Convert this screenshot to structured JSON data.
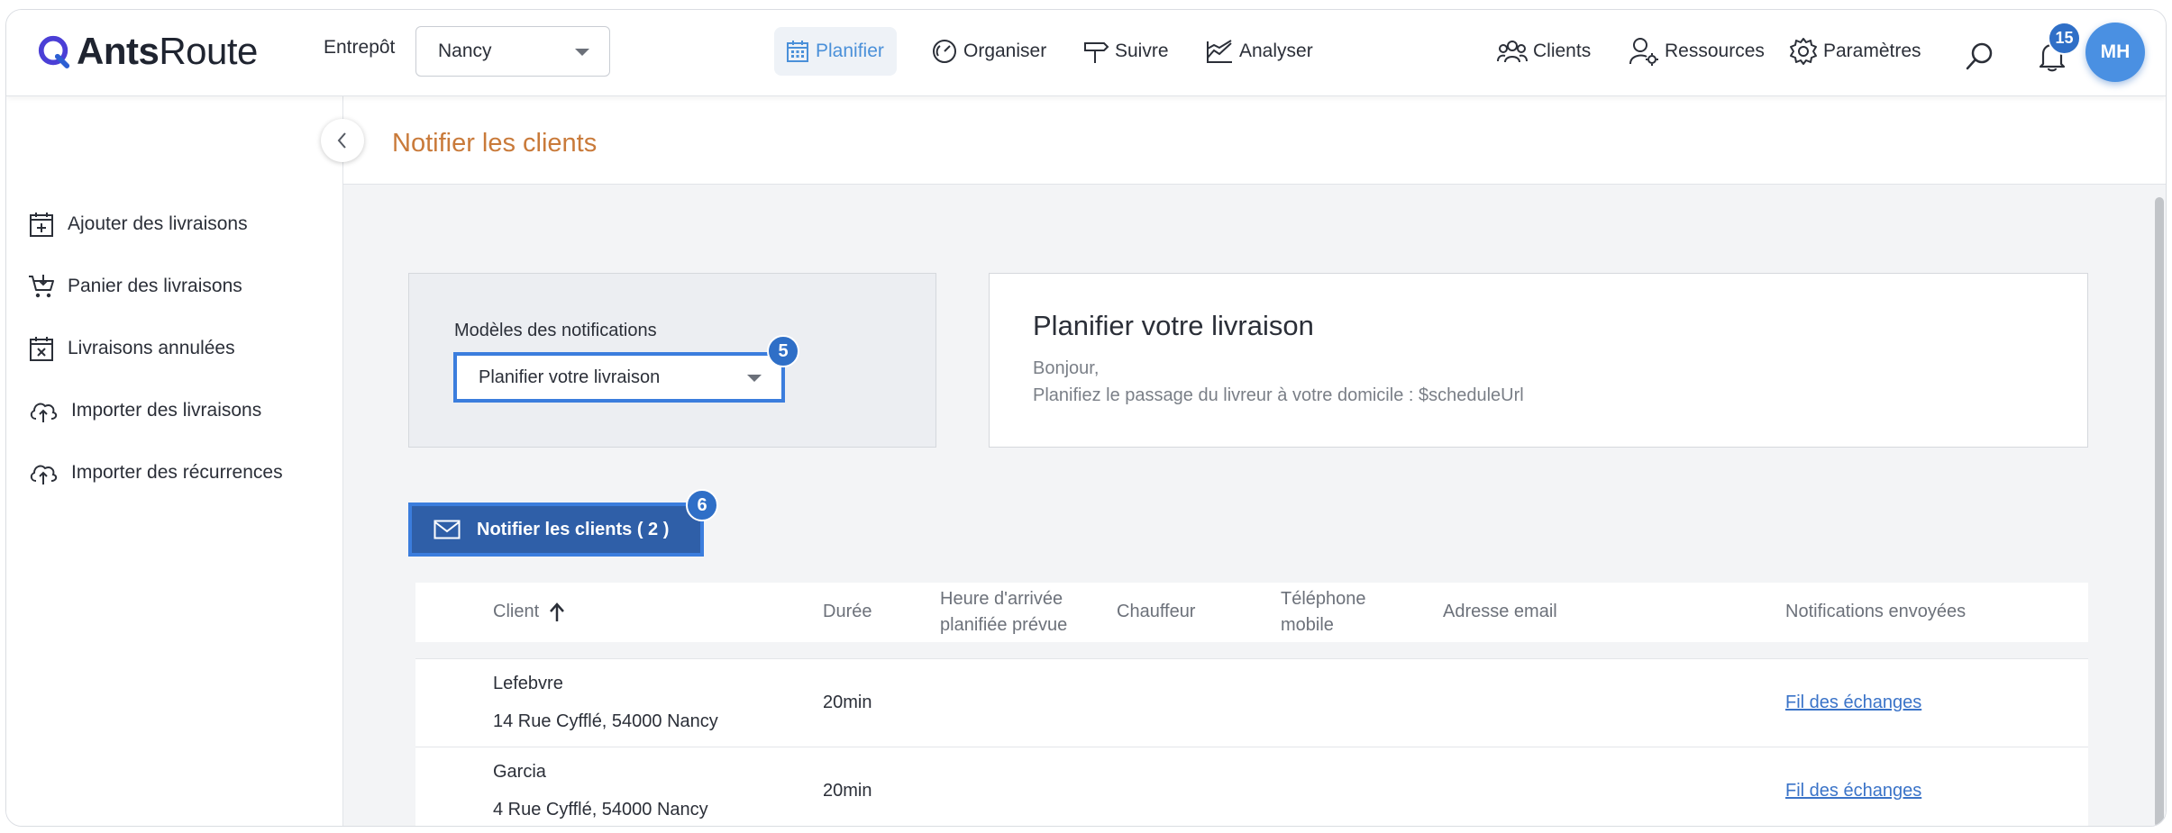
{
  "app": {
    "logo_bold": "Ants",
    "logo_light": "Route"
  },
  "warehouse": {
    "label": "Entrepôt",
    "value": "Nancy"
  },
  "nav": {
    "planifier": "Planifier",
    "organiser": "Organiser",
    "suivre": "Suivre",
    "analyser": "Analyser",
    "clients": "Clients",
    "ressources": "Ressources",
    "parametres": "Paramètres"
  },
  "notifications": {
    "count": "15"
  },
  "user": {
    "initials": "MH"
  },
  "sidebar": {
    "items": [
      {
        "label": "Ajouter des livraisons",
        "icon": "calendar-plus-icon"
      },
      {
        "label": "Panier des livraisons",
        "icon": "cart-icon"
      },
      {
        "label": "Livraisons annulées",
        "icon": "calendar-x-icon"
      },
      {
        "label": "Importer des livraisons",
        "icon": "cloud-upload-icon"
      },
      {
        "label": "Importer des récurrences",
        "icon": "cloud-upload-icon"
      }
    ]
  },
  "page": {
    "title": "Notifier les clients"
  },
  "templates": {
    "label": "Modèles des notifications",
    "selected": "Planifier votre livraison",
    "step_badge": "5"
  },
  "preview": {
    "title": "Planifier votre livraison",
    "line1": "Bonjour,",
    "line2": "Planifiez le passage du livreur à votre domicile : $scheduleUrl"
  },
  "notify_button": {
    "label": "Notifier les clients ( 2 )",
    "step_badge": "6"
  },
  "table": {
    "headers": {
      "client": "Client",
      "duree": "Durée",
      "heure_l1": "Heure d'arrivée",
      "heure_l2": "planifiée prévue",
      "chauffeur": "Chauffeur",
      "tel_l1": "Téléphone",
      "tel_l2": "mobile",
      "email": "Adresse email",
      "notifs": "Notifications envoyées"
    },
    "rows": [
      {
        "name": "Lefebvre",
        "address": "14 Rue Cyfflé, 54000 Nancy",
        "duration": "20min",
        "link": "Fil des échanges"
      },
      {
        "name": "Garcia",
        "address": "4 Rue Cyfflé, 54000 Nancy",
        "duration": "20min",
        "link": "Fil des échanges"
      }
    ]
  },
  "colors": {
    "accent": "#3b7ddd",
    "title_orange": "#c97a3a",
    "button_blue": "#2f5fa8",
    "badge_blue": "#2f6fc7"
  }
}
